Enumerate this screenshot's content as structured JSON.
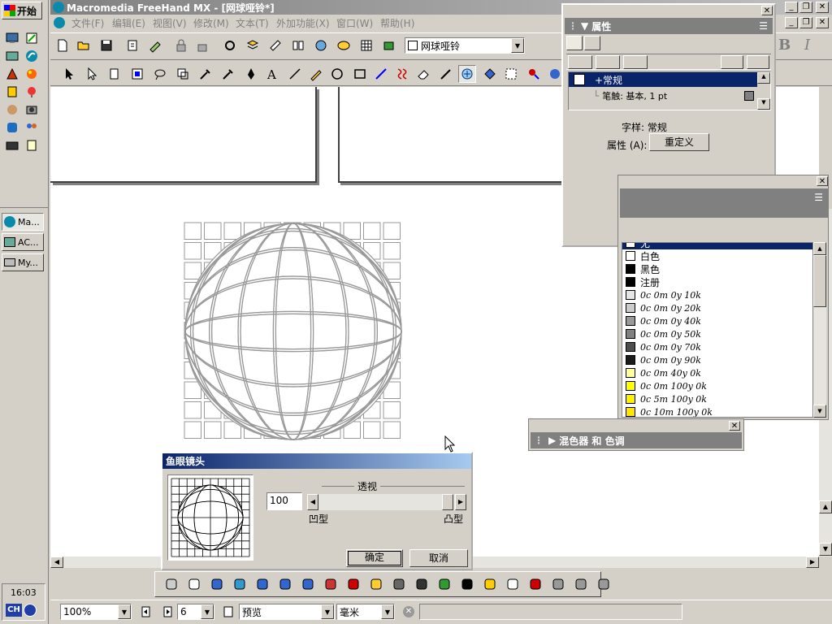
{
  "taskbar": {
    "start_label": "开始",
    "tasks": [
      {
        "label": "Ma..."
      },
      {
        "label": "AC..."
      },
      {
        "label": "My..."
      }
    ],
    "clock": "16:03",
    "lang": "CH"
  },
  "app": {
    "title": "Macromedia FreeHand MX - [网球哑铃*]",
    "menus": [
      "文件(F)",
      "编辑(E)",
      "视图(V)",
      "修改(M)",
      "文本(T)",
      "外加功能(X)",
      "窗口(W)",
      "帮助(H)"
    ],
    "document_select": "网球哑铃"
  },
  "properties_panel": {
    "title": "属性",
    "tree_root": "+常规",
    "tree_child": "笔触: 基本, 1 pt",
    "style_label": "字样: 常规",
    "attr_label": "属性 (A):",
    "redefine_button": "重定义"
  },
  "swatches_panel": {
    "items": [
      {
        "label": "无",
        "color": "#ffffff",
        "plain": true,
        "selected": true
      },
      {
        "label": "白色",
        "color": "#ffffff",
        "plain": true
      },
      {
        "label": "黑色",
        "color": "#000000",
        "plain": true
      },
      {
        "label": "注册",
        "color": "#000000",
        "plain": true
      },
      {
        "label": "0c 0m 0y 10k",
        "color": "#e6e6e6"
      },
      {
        "label": "0c 0m 0y 20k",
        "color": "#cccccc"
      },
      {
        "label": "0c 0m 0y 40k",
        "color": "#999999"
      },
      {
        "label": "0c 0m 0y 50k",
        "color": "#808080"
      },
      {
        "label": "0c 0m 0y 70k",
        "color": "#4d4d4d"
      },
      {
        "label": "0c 0m 0y 90k",
        "color": "#1a1a1a"
      },
      {
        "label": "0c 0m 40y 0k",
        "color": "#ffff99"
      },
      {
        "label": "0c 0m 100y 0k",
        "color": "#ffff00"
      },
      {
        "label": "0c 5m 100y 0k",
        "color": "#fff200"
      },
      {
        "label": "0c 10m 100y 0k",
        "color": "#ffe600"
      }
    ]
  },
  "mixer_panel": {
    "title": "混色器 和 色调"
  },
  "fisheye_dialog": {
    "title": "鱼眼镜头",
    "group_label": "透视",
    "value": "100",
    "slider_fraction": 1.0,
    "concave_label": "凹型",
    "convex_label": "凸型",
    "ok_button": "确定",
    "cancel_button": "取消"
  },
  "statusbar": {
    "zoom": "100%",
    "page": "6",
    "view_mode": "预览",
    "units": "毫米"
  },
  "colors": {
    "title_active": "#0a246a",
    "panel_title": "#808080",
    "selection": "#0a246a"
  }
}
